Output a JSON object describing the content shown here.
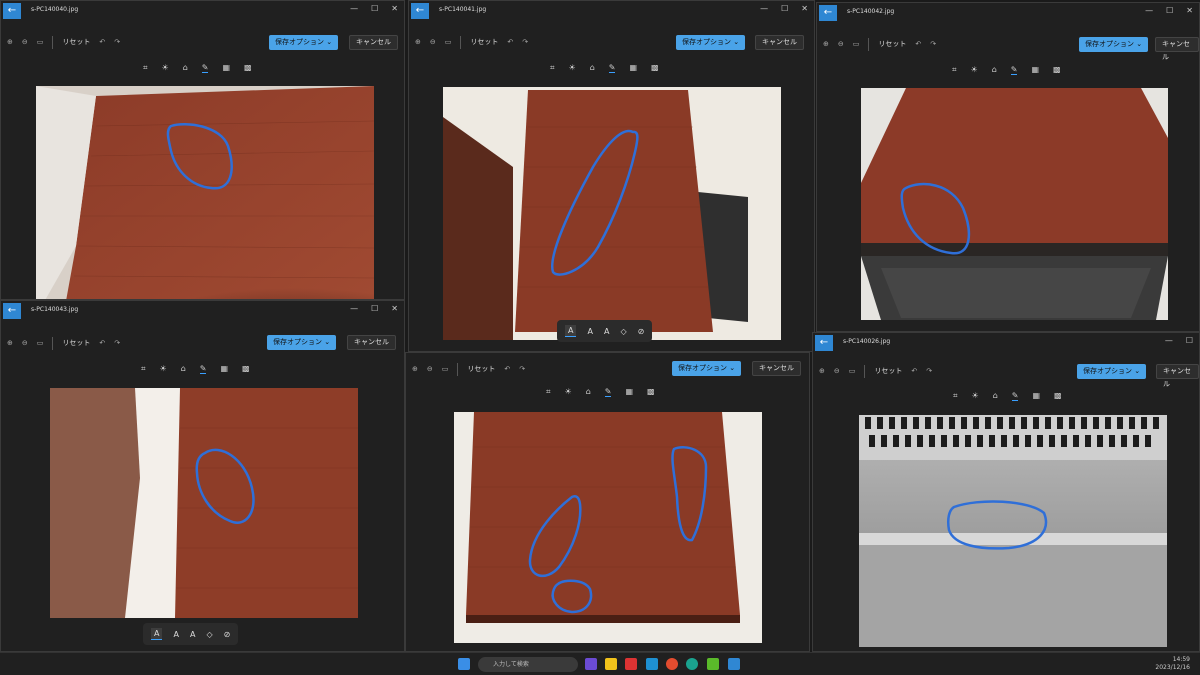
{
  "windows": [
    {
      "title": "s-PC140040.jpg"
    },
    {
      "title": "s-PC140041.jpg"
    },
    {
      "title": "s-PC140042.jpg"
    },
    {
      "title": "s-PC140043.jpg"
    },
    {
      "title": "s-PC140026.jpg"
    }
  ],
  "toolbar": {
    "reset": "リセット",
    "save": "保存オプション",
    "cancel": "キャンセル"
  },
  "taskbar": {
    "search_placeholder": "入力して検索",
    "time": "14:59",
    "date": "2023/12/16"
  },
  "colors": {
    "accent": "#4aa3e8",
    "wood": "#8a3a28",
    "annotation": "#2f6fd8"
  }
}
